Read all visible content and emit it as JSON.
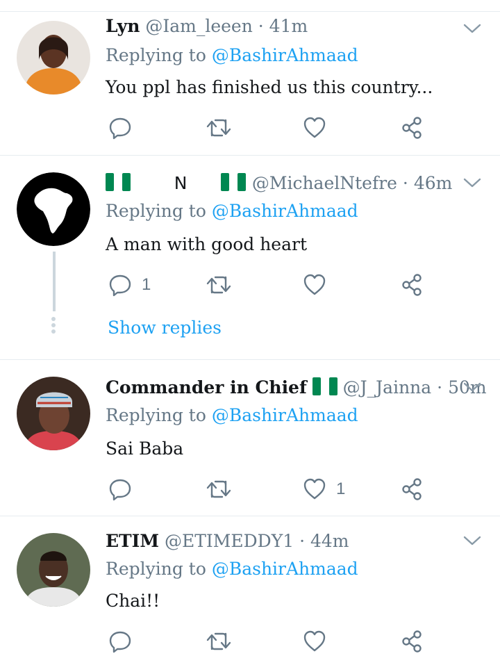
{
  "tweets": [
    {
      "name": "Lyn",
      "handle": "@Iam_leeen",
      "sep": "·",
      "time": "41m",
      "replying_prefix": "Replying to",
      "replying_to": "@BashirAhmaad",
      "text": "You ppl has finished us this country...",
      "reply_count": "",
      "like_count": ""
    },
    {
      "name_flag_left": "nigeria-flag-icon",
      "name_letter": "N",
      "name_flag_right": "nigeria-flag-icon",
      "handle": "@MichaelNtefre",
      "sep": "·",
      "time": "46m",
      "replying_prefix": "Replying to",
      "replying_to": "@BashirAhmaad",
      "text": "A man with good heart",
      "reply_count": "1",
      "like_count": "",
      "show_replies": "Show replies"
    },
    {
      "name": "Commander in Chief",
      "handle": "@J_Jainna",
      "sep": "·",
      "time": "50m",
      "replying_prefix": "Replying to",
      "replying_to": "@BashirAhmaad",
      "text": "Sai Baba",
      "reply_count": "",
      "like_count": "1"
    },
    {
      "name": "ETIM",
      "handle": "@ETIMEDDY1",
      "sep": "·",
      "time": "44m",
      "replying_prefix": "Replying to",
      "replying_to": "@BashirAhmaad",
      "text": "Chai!!",
      "reply_count": "",
      "like_count": ""
    }
  ],
  "colors": {
    "accent": "#1da1f2",
    "secondary_text": "#657786",
    "divider": "#e6ecf0",
    "flag_green": "#008751"
  },
  "icons": [
    "reply-icon",
    "retweet-icon",
    "like-icon",
    "share-icon",
    "chevron-down-icon"
  ]
}
